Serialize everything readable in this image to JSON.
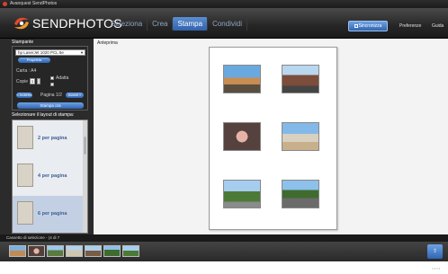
{
  "window": {
    "title": "Avanquest SendPhotos"
  },
  "header": {
    "brand": "SENDPHOTOS",
    "nav": [
      {
        "label": "Seleziona"
      },
      {
        "label": "Crea"
      },
      {
        "label": "Stampa"
      },
      {
        "label": "Condividi"
      }
    ],
    "active_tab": "Stampa",
    "blue_button": "Sincronizza",
    "preferences": "Preferenze",
    "guide": "Guida"
  },
  "stampante": {
    "title": "Stampante",
    "printer_value": "hp LaserJet 1020 PCL 5e",
    "properties_button": "Proprieta",
    "paper_label": "Carta : A4",
    "copies_label": "Copie",
    "copies_value": "1",
    "fit_label": "Adatta",
    "prev_button": "< Indietro",
    "page_label": "Pagina 1/2",
    "next_button": "Avanti >",
    "print_button": "Stampa ora"
  },
  "layouts": {
    "title": "Selezionare il layout di stampa:",
    "items": [
      {
        "label": "2 per pagina"
      },
      {
        "label": "4 per pagina"
      },
      {
        "label": "6 per pagina"
      }
    ],
    "selected": "6 per pagina"
  },
  "preview": {
    "title": "Anteprima"
  },
  "filmstrip": {
    "title": "Cassetto di selezione - (4 di 7"
  }
}
